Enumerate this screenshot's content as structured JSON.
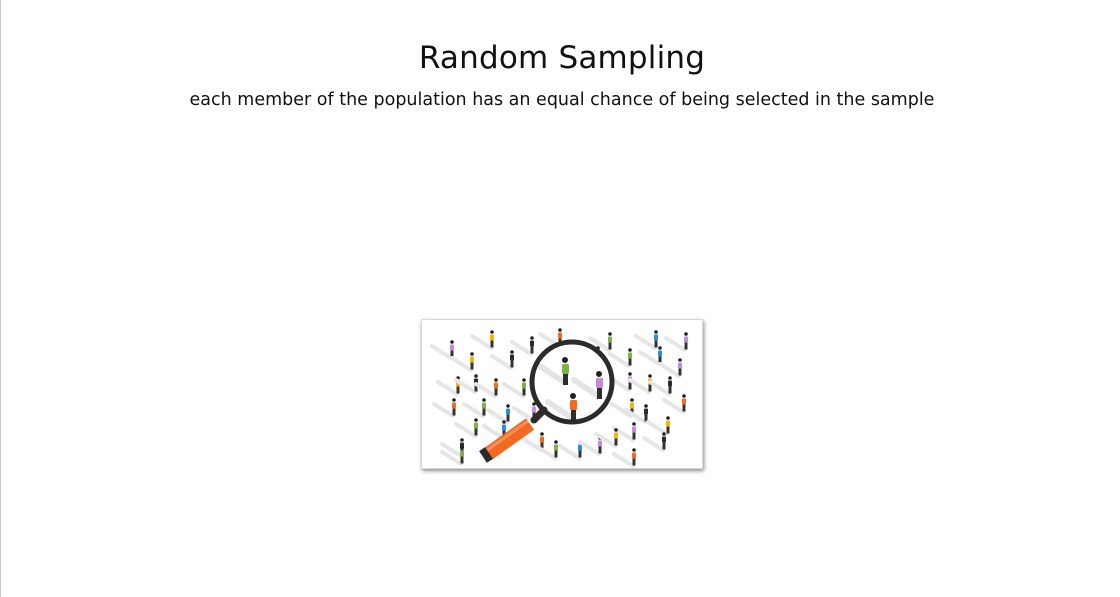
{
  "slide": {
    "title": "Random Sampling",
    "subtitle": "each member of the population has an equal chance of being selected in the sample"
  },
  "illustration": {
    "icon": "magnifying-glass-over-crowd-icon",
    "colors": {
      "orange": "#f26a21",
      "green": "#7cb342",
      "blue": "#2a8fd1",
      "purple": "#c48ad6",
      "yellow": "#f4b400",
      "dark": "#2b2b2b"
    }
  }
}
